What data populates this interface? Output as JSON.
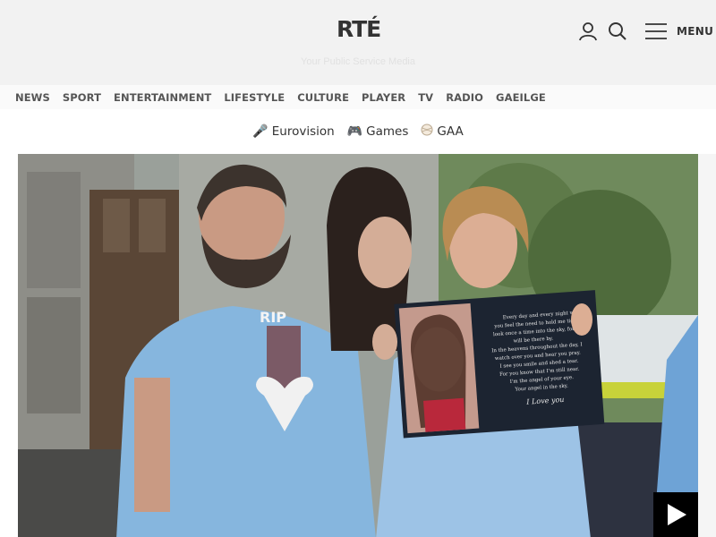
{
  "header": {
    "logo": "RTÉ",
    "tagline": "Your Public Service Media",
    "menu_label": "MENU",
    "icons": [
      "user-icon",
      "search-icon",
      "hamburger-icon"
    ]
  },
  "nav": {
    "items": [
      "NEWS",
      "SPORT",
      "ENTERTAINMENT",
      "LIFESTYLE",
      "CULTURE",
      "PLAYER",
      "TV",
      "RADIO",
      "GAEILGE"
    ]
  },
  "quick_links": [
    {
      "label": "Eurovision",
      "icon": "microphone-icon"
    },
    {
      "label": "Games",
      "icon": "gamepad-icon"
    },
    {
      "label": "GAA",
      "icon": "gaa-ball-icon"
    }
  ],
  "hero": {
    "shirt_text": "RIP",
    "placard_lines": [
      "Every day and every night when",
      "you feel the need to hold me tight,",
      "look once a time into the sky, for I",
      "will be there by.",
      "In the heavens throughout the day, I",
      "watch over you and hear you pray.",
      "I see you smile and shed a tear.",
      "For you know that I'm still near.",
      "I'm the angel of your eye.",
      "Your angel in the sky.",
      "I Love you"
    ],
    "play_icon": "play-icon"
  }
}
